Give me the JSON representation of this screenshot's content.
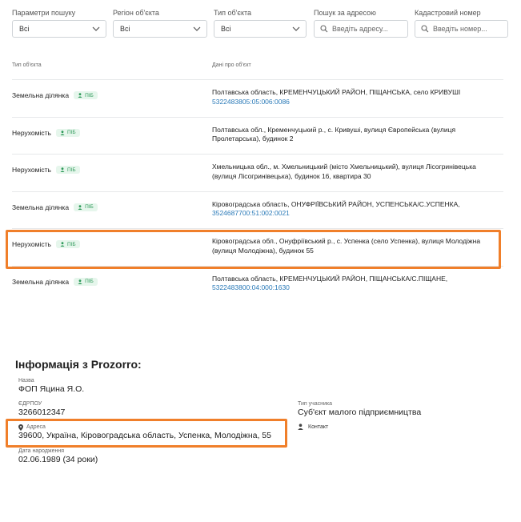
{
  "filters": {
    "search_params": {
      "label": "Параметри пошуку",
      "value": "Всі"
    },
    "region": {
      "label": "Регіон об'єкта",
      "value": "Всі"
    },
    "object_type": {
      "label": "Тип об'єкта",
      "value": "Всі"
    },
    "address_search": {
      "label": "Пошук за адресою",
      "placeholder": "Введіть адресу..."
    },
    "cadastral": {
      "label": "Кадастровий номер",
      "placeholder": "Введіть номер..."
    }
  },
  "table": {
    "headers": {
      "type": "Тип об'єкта",
      "info": "Дані про об'єкт"
    },
    "rows": [
      {
        "type": "Земельна ділянка",
        "badge": "ПІБ",
        "line1": "Полтавська область, КРЕМЕНЧУЦЬКИЙ РАЙОН, ПІЩАНСЬКА, село КРИВУШІ",
        "line2": "",
        "link": "5322483805:05:006:0086"
      },
      {
        "type": "Нерухомість",
        "badge": "ПІБ",
        "line1": "Полтавська обл., Кременчуцький р., с. Кривуші, вулиця Європейська (вулиця",
        "line2": "Пролетарська), будинок 2",
        "link": ""
      },
      {
        "type": "Нерухомість",
        "badge": "ПІБ",
        "line1": "Хмельницька обл., м. Хмельницький (місто Хмельницький), вулиця Лісогринівецька",
        "line2": "(вулиця Лісогринівецька), будинок 16, квартира 30",
        "link": ""
      },
      {
        "type": "Земельна ділянка",
        "badge": "ПІБ",
        "line1": "Кіровоградська область, ОНУФРІЇВСЬКИЙ РАЙОН, УСПЕНСЬКА/С.УСПЕНКА,",
        "line2": "",
        "link": "3524687700:51:002:0021"
      },
      {
        "type": "Нерухомість",
        "badge": "ПІБ",
        "line1": "Кіровоградська обл., Онуфріївський р., с. Успенка (село Успенка), вулиця Молодіжна",
        "line2": "(вулиця Молодіжна), будинок 55",
        "link": ""
      },
      {
        "type": "Земельна ділянка",
        "badge": "ПІБ",
        "line1": "Полтавська область, КРЕМЕНЧУЦЬКИЙ РАЙОН, ПІЩАНСЬКА/С.ПІЩАНЕ,",
        "line2": "",
        "link": "5322483800:04:000:1630"
      }
    ]
  },
  "prozorro": {
    "title": "Інформація з Prozorro:",
    "name": {
      "label": "Назва",
      "value": "ФОП Яцина Я.О."
    },
    "edrpou": {
      "label": "ЄДРПОУ",
      "value": "3266012347"
    },
    "participant_type": {
      "label": "Тип учасника",
      "value": "Суб'єкт малого підприємництва"
    },
    "contact": "Контакт",
    "address": {
      "label": "Адреса",
      "value": "39600, Україна, Кіровоградська область, Успенка, Молодіжна, 55"
    },
    "birth": {
      "label": "Дата народження",
      "value": "02.06.1989 (34 роки)"
    }
  },
  "colors": {
    "highlight": "#f07f2a",
    "link": "#2a7ab8",
    "badge_bg": "#e6f6ec",
    "badge_fg": "#2f9a5a"
  }
}
